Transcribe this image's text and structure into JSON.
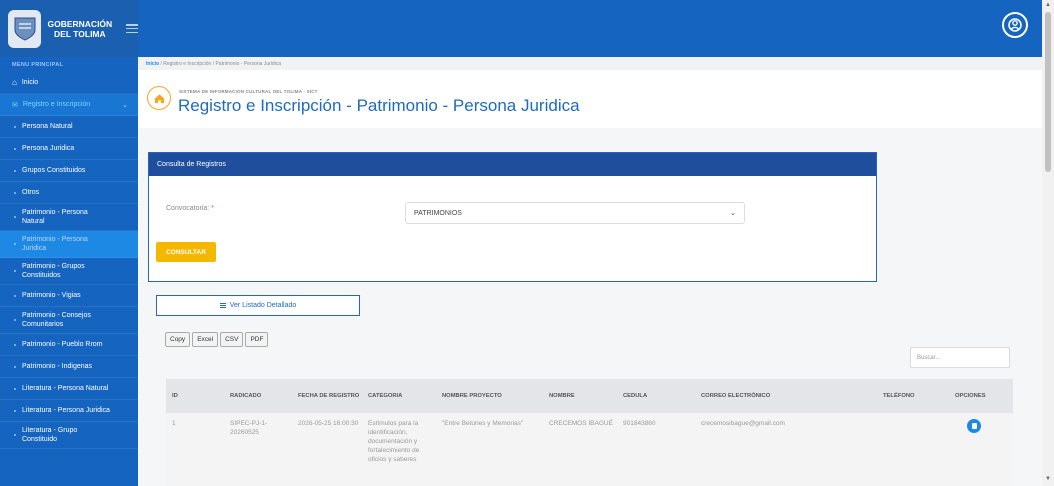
{
  "brand": {
    "line1": "GOBERNACIÓN",
    "line2": "DEL TOLIMA"
  },
  "sidebar": {
    "menu_title": "MENU PRINCIPAL",
    "items": [
      {
        "label": "Inicio"
      },
      {
        "label": "Registro e Inscripción"
      },
      {
        "label": "Persona Natural"
      },
      {
        "label": "Persona Juridica"
      },
      {
        "label": "Grupos Constituidos"
      },
      {
        "label": "Otros"
      },
      {
        "label": "Patrimonio - Persona Natural"
      },
      {
        "label": "Patrimonio - Persona Juridica"
      },
      {
        "label": "Patrimonio - Grupos Constituidos"
      },
      {
        "label": "Patrimonio - Vigias"
      },
      {
        "label": "Patrimonio - Consejos Comunitarios"
      },
      {
        "label": "Patrimonio - Pueblo Rrom"
      },
      {
        "label": "Patrimonio - Indigenas"
      },
      {
        "label": "Literatura - Persona Natural"
      },
      {
        "label": "Literatura - Persona Juridica"
      },
      {
        "label": "Literatura - Grupo Constituido"
      }
    ]
  },
  "breadcrumb": {
    "home": "Inicio",
    "rest": " / Registro e Inscripción / Patrimonio - Persona Juridica"
  },
  "header": {
    "system": "SISTEMA DE INFORMACION CULTURAL DEL TOLIMA - SICT",
    "title": "Registro e Inscripción - Patrimonio - Persona Juridica"
  },
  "card": {
    "title": "Consulta de Registros",
    "conv_label": "Convocatoria:",
    "required_mark": "*",
    "conv_value": "PATRIMONIOS",
    "consult_button": "CONSULTAR"
  },
  "detail_button": "Ver Listado Detallado",
  "export_buttons": [
    "Copy",
    "Excel",
    "CSV",
    "PDF"
  ],
  "search_placeholder": "Buscar...",
  "table": {
    "headers": [
      "ID",
      "RADICADO",
      "FECHA DE REGISTRO",
      "CATEGORIA",
      "NOMBRE PROYECTO",
      "NOMBRE",
      "CEDULA",
      "CORREO ELECTRÓNICO",
      "TELÉFONO",
      "OPCIONES"
    ],
    "rows": [
      {
        "id": "1",
        "radicado": "SIPEC-PJ-1-20260525",
        "fecha": "2026-05-25 16:00:30",
        "categoria": "Estímulos para la identificación, documentación y fortalecimiento de oficios y saberes",
        "proyecto": "\"Entre Betunes y Memorias\"",
        "nombre": "CRECEMOS IBAGUÉ",
        "cedula": "901843860",
        "correo": "crecemosibague@gmail.com",
        "telefono": ""
      }
    ]
  }
}
